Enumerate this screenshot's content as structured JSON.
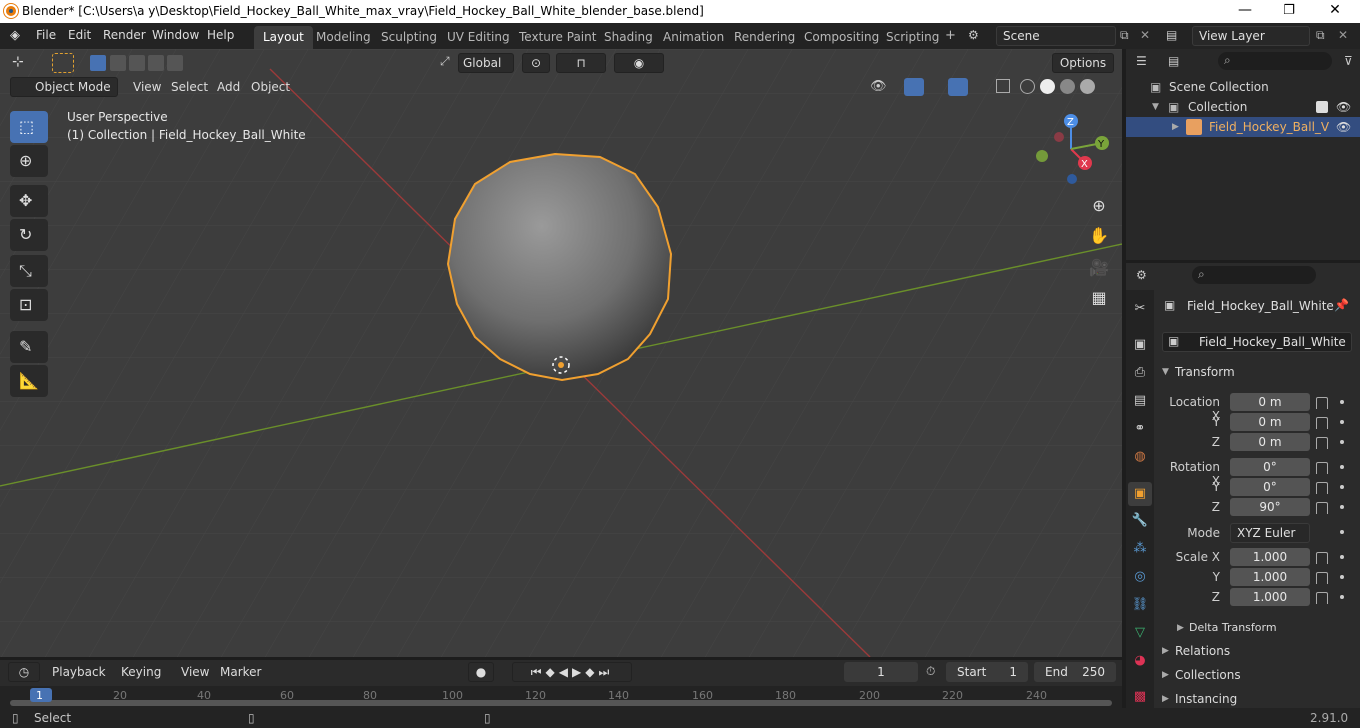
{
  "window": {
    "title": "Blender* [C:\\Users\\a y\\Desktop\\Field_Hockey_Ball_White_max_vray\\Field_Hockey_Ball_White_blender_base.blend]",
    "minimize": "—",
    "maximize": "❐",
    "close": "✕"
  },
  "menu": [
    "File",
    "Edit",
    "Render",
    "Window",
    "Help"
  ],
  "workspaces": [
    "Layout",
    "Modeling",
    "Sculpting",
    "UV Editing",
    "Texture Paint",
    "Shading",
    "Animation",
    "Rendering",
    "Compositing",
    "Scripting"
  ],
  "scene": {
    "name": "Scene",
    "view_layer": "View Layer"
  },
  "toolbar": {
    "orientation": "Global",
    "options": "Options"
  },
  "viewport_header": {
    "mode": "Object Mode",
    "menus": [
      "View",
      "Select",
      "Add",
      "Object"
    ]
  },
  "viewport": {
    "perspective": "User Perspective",
    "collection_info": "(1) Collection | Field_Hockey_Ball_White",
    "gizmo": {
      "x": "X",
      "y": "Y",
      "z": "Z"
    }
  },
  "outliner": {
    "scene_collection": "Scene Collection",
    "collection": "Collection",
    "object": "Field_Hockey_Ball_V"
  },
  "properties": {
    "object_name": "Field_Hockey_Ball_White",
    "data_name": "Field_Hockey_Ball_White",
    "transform_title": "Transform",
    "location": {
      "label": "Location X",
      "x": "0 m",
      "y": "0 m",
      "z": "0 m"
    },
    "rotation": {
      "label": "Rotation X",
      "x": "0°",
      "y": "0°",
      "z": "90°"
    },
    "mode_label": "Mode",
    "mode": "XYZ Euler",
    "scale": {
      "label": "Scale X",
      "x": "1.000",
      "y": "1.000",
      "z": "1.000"
    },
    "axis_y": "Y",
    "axis_z": "Z",
    "sections": [
      "Delta Transform",
      "Relations",
      "Collections",
      "Instancing"
    ]
  },
  "timeline": {
    "menus": [
      "Playback",
      "Keying",
      "View",
      "Marker"
    ],
    "current_frame": "1",
    "start_label": "Start",
    "start": "1",
    "end_label": "End",
    "end": "250",
    "ticks": [
      "1",
      "20",
      "40",
      "60",
      "80",
      "100",
      "120",
      "140",
      "160",
      "180",
      "200",
      "220",
      "240"
    ]
  },
  "status": {
    "select": "Select",
    "version": "2.91.0"
  }
}
